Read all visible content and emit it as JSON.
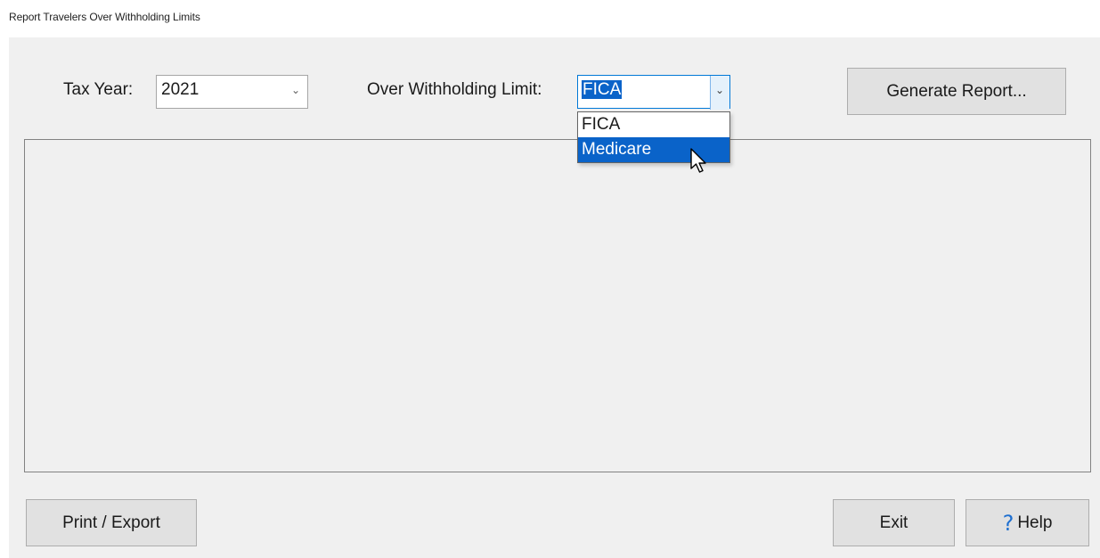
{
  "window": {
    "title": "Report Travelers Over Withholding Limits"
  },
  "tax_year": {
    "label": "Tax Year:",
    "value": "2021"
  },
  "withholding_limit": {
    "label": "Over Withholding Limit:",
    "value": "FICA",
    "options": [
      "FICA",
      "Medicare"
    ],
    "highlighted_option": "Medicare"
  },
  "buttons": {
    "generate": "Generate Report...",
    "print_export": "Print / Export",
    "exit": "Exit",
    "help": "Help"
  },
  "icons": {
    "combo_arrow": "chevron-down-icon",
    "help": "question-mark-icon",
    "cursor": "mouse-pointer-icon"
  },
  "colors": {
    "selection": "#0a63c9",
    "form_background": "#f0f0f0",
    "button_background": "#e1e1e1",
    "help_icon": "#1e6fd0"
  }
}
